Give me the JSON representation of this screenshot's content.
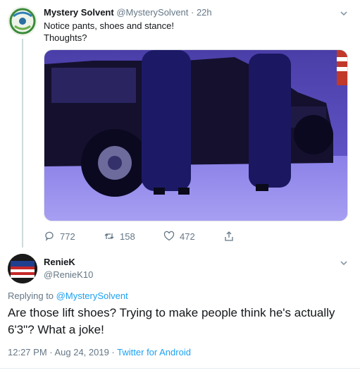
{
  "tweet1": {
    "author_name": "Mystery Solvent",
    "author_handle": "@MysterySolvent",
    "time": "· 22h",
    "text_line1": "Notice pants, shoes and stance!",
    "text_line2": "Thoughts?",
    "image_icon": "photo-of-men-beside-black-suv",
    "actions": {
      "reply_count": "772",
      "retweet_count": "158",
      "like_count": "472"
    }
  },
  "tweet2": {
    "author_name": "RenieK",
    "author_handle": "@RenieK10",
    "replying_prefix": "Replying to",
    "replying_to": "@MysterySolvent",
    "text": "Are those lift shoes? Trying to make people think he's actually 6'3\"? What a joke!",
    "timestamp": "12:27 PM · Aug 24, 2019 ·",
    "source": "Twitter for Android"
  },
  "colors": {
    "link": "#1da1f2",
    "muted": "#657786",
    "text": "#14171a"
  }
}
